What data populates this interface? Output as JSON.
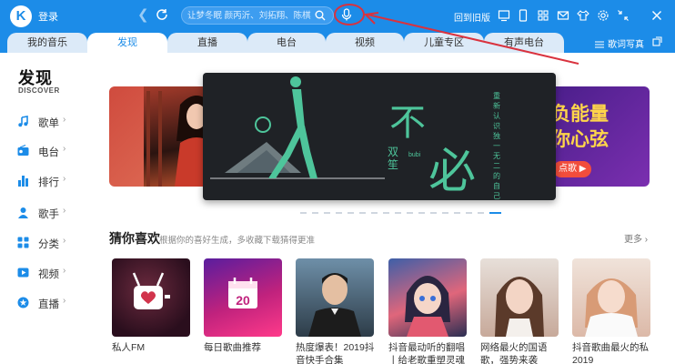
{
  "titlebar": {
    "logo_letter": "K",
    "login_label": "登录",
    "search_placeholder": "让梦冬眠 颜丙沂、刘拓翔、陈棋尔、张.",
    "return_old_label": "回到旧版",
    "accent_color": "#1c8ce8",
    "annotation_color": "#d9323e"
  },
  "tabs": [
    {
      "label": "我的音乐",
      "active": false
    },
    {
      "label": "发现",
      "active": true
    },
    {
      "label": "直播",
      "active": false
    },
    {
      "label": "电台",
      "active": false
    },
    {
      "label": "视频",
      "active": false
    },
    {
      "label": "儿童专区",
      "active": false
    },
    {
      "label": "有声电台",
      "active": false
    }
  ],
  "tabbar_right": {
    "lyrics_label": "歌词写真"
  },
  "sidebar": {
    "title": "发现",
    "subtitle": "DISCOVER",
    "items": [
      {
        "label": "歌单",
        "icon": "music-note-icon"
      },
      {
        "label": "电台",
        "icon": "radio-icon"
      },
      {
        "label": "排行",
        "icon": "bar-chart-icon"
      },
      {
        "label": "歌手",
        "icon": "person-icon"
      },
      {
        "label": "分类",
        "icon": "grid-icon"
      },
      {
        "label": "视频",
        "icon": "video-icon"
      },
      {
        "label": "直播",
        "icon": "live-star-icon"
      }
    ]
  },
  "banner": {
    "main_title_1": "不",
    "main_title_2": "必",
    "main_artist": "双笙",
    "main_pinyin": "bubi",
    "main_vertical": "重新认识独一无二的自己",
    "right_line1": "负能量",
    "right_line2": "你心弦",
    "right_button": "点歌 ▶"
  },
  "recommend": {
    "title": "猜你喜欢",
    "subtitle": "根据你的喜好生成，多收藏下载猜得更准",
    "more_label": "更多",
    "cards": [
      {
        "title": "私人FM"
      },
      {
        "title": "每日歌曲推荐",
        "calendar_day": "20"
      },
      {
        "title": "热度爆表！2019抖音快手合集"
      },
      {
        "title": "抖音最动听的翻唱丨给老歌重塑灵魂"
      },
      {
        "title": "网络最火的国语歌，强势来袭"
      },
      {
        "title": "抖音歌曲最火的私2019"
      }
    ]
  }
}
